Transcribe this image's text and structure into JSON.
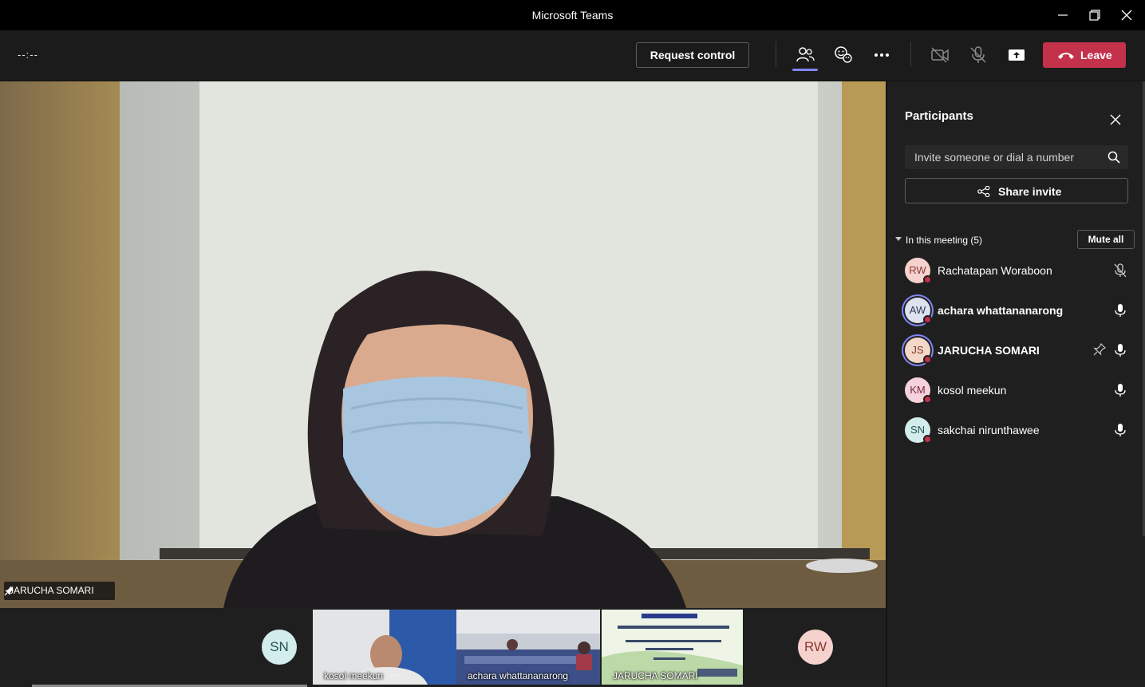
{
  "window": {
    "title": "Microsoft Teams"
  },
  "toolbar": {
    "timer": "--:--",
    "request_control": "Request control",
    "leave_label": "Leave",
    "icons": [
      "participants-icon",
      "react-icon",
      "more-icon",
      "camera-off-icon",
      "mic-off-icon",
      "share-screen-icon",
      "phone-hangup-icon"
    ]
  },
  "stage": {
    "speaker_name": "JARUCHA SOMARI"
  },
  "filmstrip": {
    "items": [
      {
        "initials": "SN"
      },
      {
        "label": "kosol meekun",
        "more": "···"
      },
      {
        "label": "achara whattananarong"
      },
      {
        "label": "JARUCHA SOMARI"
      },
      {
        "initials": "RW"
      }
    ]
  },
  "panel": {
    "title": "Participants",
    "invite_placeholder": "Invite someone or dial a number",
    "share_invite": "Share invite",
    "section_title": "In this meeting (5)",
    "mute_all": "Mute all",
    "participants": [
      {
        "initials": "RW",
        "name": "Rachatapan Woraboon",
        "mic": "muted",
        "avatar_bg": "#f6d2cf",
        "avatar_fg": "#8a3a32"
      },
      {
        "initials": "AW",
        "name": "achara whattananarong",
        "mic": "on",
        "avatar_bg": "#dde2ee",
        "avatar_fg": "#303a55"
      },
      {
        "initials": "JS",
        "name": "JARUCHA SOMARI",
        "mic": "on",
        "pinned": true,
        "avatar_bg": "#f3d7c9",
        "avatar_fg": "#7b3a22"
      },
      {
        "initials": "KM",
        "name": "kosol meekun",
        "mic": "on",
        "avatar_bg": "#f6d2dc",
        "avatar_fg": "#7a2a44"
      },
      {
        "initials": "SN",
        "name": "sakchai nirunthawee",
        "mic": "on",
        "avatar_bg": "#d3ecec",
        "avatar_fg": "#265454"
      }
    ]
  },
  "colors": {
    "accent": "#7f85f5",
    "leave": "#c4314b",
    "status_busy": "#c4314b"
  }
}
